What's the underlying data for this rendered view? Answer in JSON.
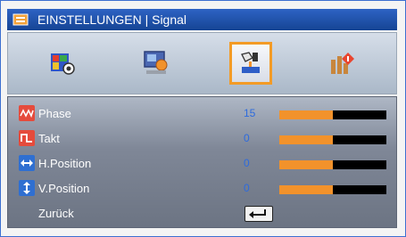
{
  "window": {
    "title": "EINSTELLUNGEN | Signal"
  },
  "tabs": [
    {
      "icon": "image-settings-icon",
      "selected": false
    },
    {
      "icon": "display-settings-icon",
      "selected": false
    },
    {
      "icon": "signal-settings-icon",
      "selected": true
    },
    {
      "icon": "system-settings-icon",
      "selected": false
    }
  ],
  "settings": {
    "rows": [
      {
        "label": "Phase",
        "value": "15",
        "level": 0.5,
        "icon": "phase-icon"
      },
      {
        "label": "Takt",
        "value": "0",
        "level": 0.5,
        "icon": "clock-icon"
      },
      {
        "label": "H.Position",
        "value": "0",
        "level": 0.5,
        "icon": "h-position-icon"
      },
      {
        "label": "V.Position",
        "value": "0",
        "level": 0.5,
        "icon": "v-position-icon"
      }
    ],
    "back_label": "Zurück"
  },
  "colors": {
    "accent": "#f39b26",
    "value_text": "#2d6bde",
    "title_bar": "#1f57b8"
  }
}
